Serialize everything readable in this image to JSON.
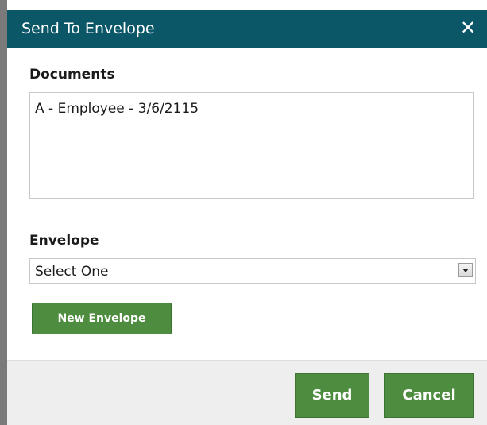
{
  "dialog": {
    "title": "Send To Envelope",
    "close_icon": "close-icon"
  },
  "documents": {
    "label": "Documents",
    "items": [
      "A - Employee - 3/6/2115"
    ]
  },
  "envelope": {
    "label": "Envelope",
    "selected": "Select One",
    "new_button": "New Envelope"
  },
  "footer": {
    "send": "Send",
    "cancel": "Cancel"
  },
  "colors": {
    "titlebar": "#0b5768",
    "button": "#4e8d3f",
    "footer": "#eeeeee"
  }
}
